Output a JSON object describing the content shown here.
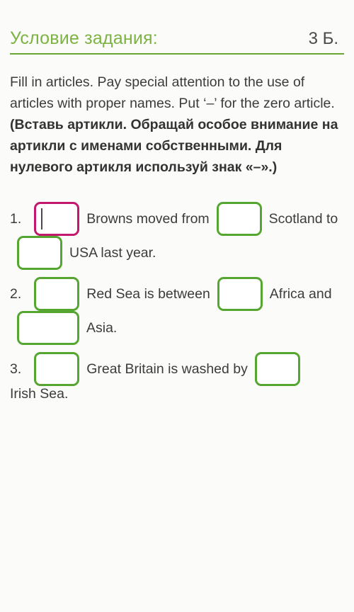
{
  "header": {
    "title": "Условие задания:",
    "score": "3 Б."
  },
  "instructions": {
    "english": "Fill in articles. Pay special attention to the use of articles with proper names. Put ‘–’ for the zero article.",
    "russian": "(Вставь артикли. Обращай особое внимание на артикли с именами собственными. Для нулевого артикля используй знак «–».)"
  },
  "questions": [
    {
      "number": "1.",
      "segments": [
        {
          "type": "blank",
          "value": "",
          "focused": true,
          "wide": false
        },
        {
          "type": "text",
          "text": "Browns moved from"
        },
        {
          "type": "blank",
          "value": "",
          "focused": false,
          "wide": false
        },
        {
          "type": "text",
          "text": "Scotland to"
        },
        {
          "type": "blank",
          "value": "",
          "focused": false,
          "wide": false
        },
        {
          "type": "text",
          "text": "USA last year."
        }
      ]
    },
    {
      "number": "2.",
      "segments": [
        {
          "type": "blank",
          "value": "",
          "focused": false,
          "wide": false
        },
        {
          "type": "text",
          "text": "Red Sea is between"
        },
        {
          "type": "blank",
          "value": "",
          "focused": false,
          "wide": false
        },
        {
          "type": "text",
          "text": "Africa and"
        },
        {
          "type": "blank",
          "value": "",
          "focused": false,
          "wide": true
        },
        {
          "type": "text",
          "text": "Asia."
        }
      ]
    },
    {
      "number": "3.",
      "segments": [
        {
          "type": "blank",
          "value": "",
          "focused": false,
          "wide": false
        },
        {
          "type": "text",
          "text": "Great Britain is washed by"
        },
        {
          "type": "blank",
          "value": "",
          "focused": false,
          "wide": false
        },
        {
          "type": "text",
          "text": "Irish Sea."
        }
      ]
    }
  ],
  "colors": {
    "accent_green": "#7cb342",
    "rule_green": "#6aa632",
    "input_border": "#55a630",
    "input_border_focused": "#c2186e",
    "background": "#fbfbf9",
    "text": "#3c3c3c"
  }
}
